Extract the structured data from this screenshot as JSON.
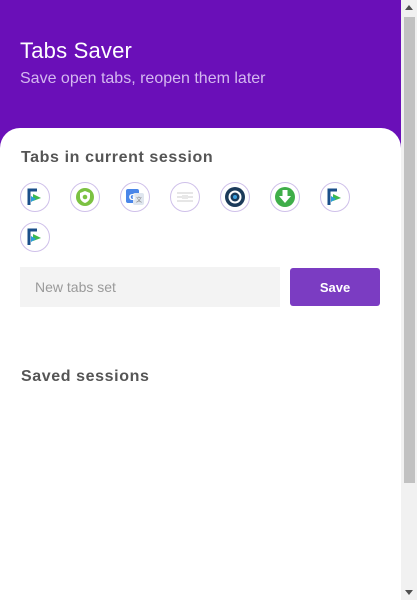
{
  "header": {
    "title": "Tabs Saver",
    "subtitle": "Save open tabs, reopen them later",
    "background_color": "#6a0fb8"
  },
  "current_session": {
    "title": "Tabs in current session",
    "tabs": [
      {
        "icon": "flag-logo-icon"
      },
      {
        "icon": "green-shield-icon"
      },
      {
        "icon": "google-translate-icon"
      },
      {
        "icon": "faded-lines-icon"
      },
      {
        "icon": "target-circle-icon"
      },
      {
        "icon": "green-download-icon"
      },
      {
        "icon": "flag-logo-icon"
      },
      {
        "icon": "flag-logo-icon"
      }
    ]
  },
  "new_set": {
    "placeholder": "New tabs set",
    "save_label": "Save",
    "button_color": "#7b3cc2"
  },
  "saved_sessions": {
    "title": "Saved sessions"
  }
}
